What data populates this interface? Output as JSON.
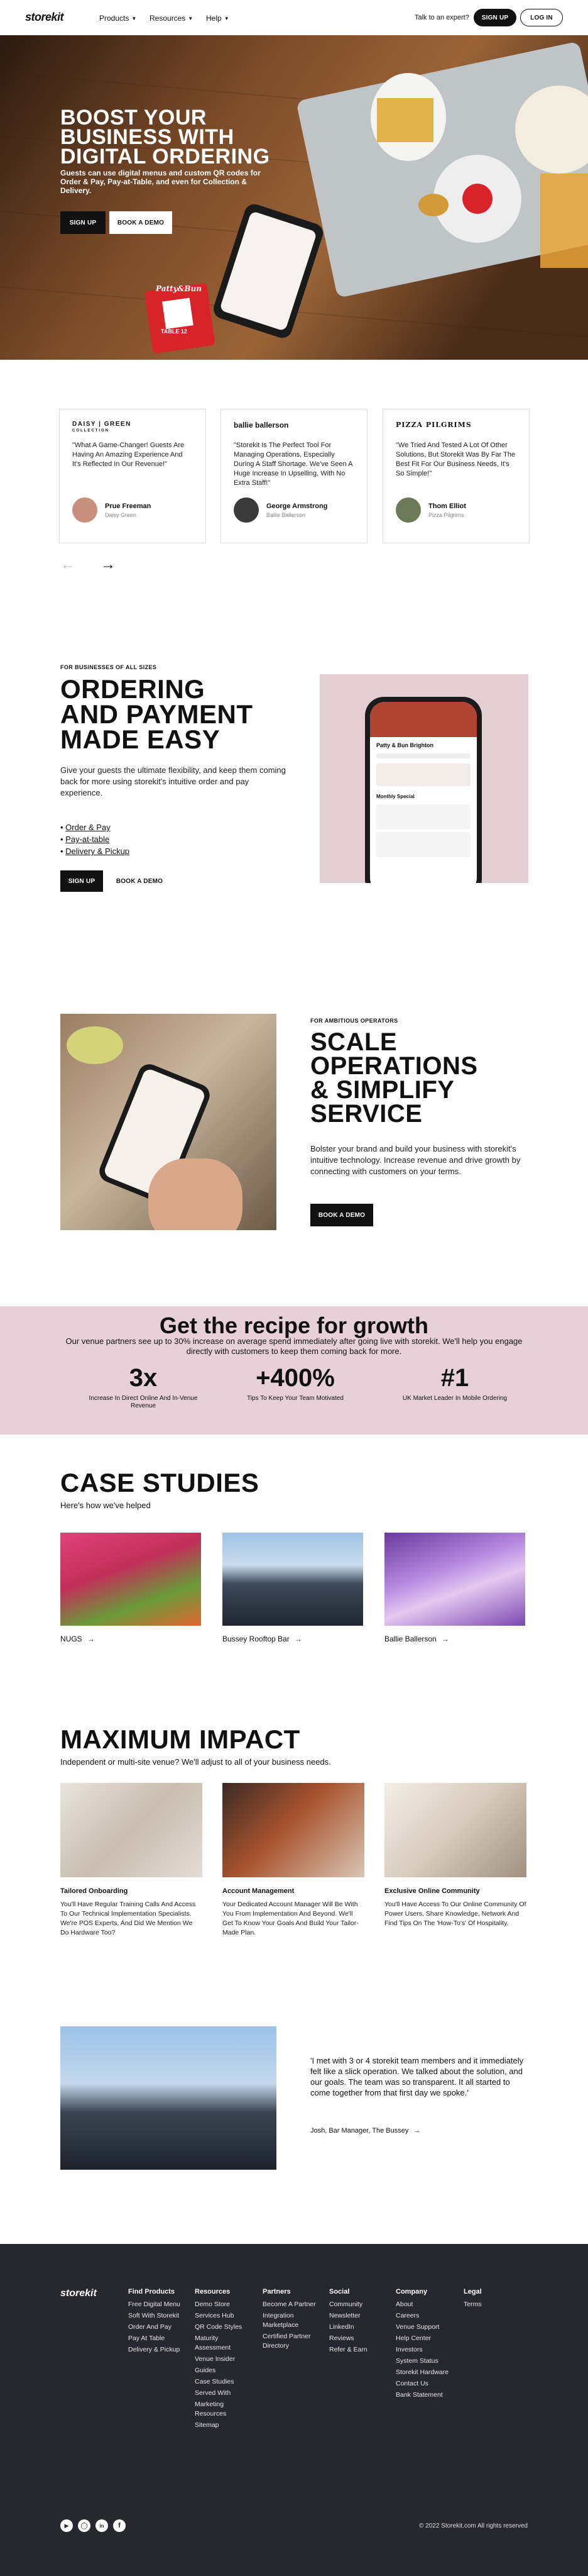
{
  "header": {
    "logo": "storekit",
    "nav": [
      {
        "label": "Products"
      },
      {
        "label": "Resources"
      },
      {
        "label": "Help"
      }
    ],
    "talk_link": "Talk to an expert?",
    "signup_label": "SIGN UP",
    "login_label": "LOG IN"
  },
  "hero": {
    "title_lines": [
      "BOOST YOUR",
      "BUSINESS WITH",
      "DIGITAL ORDERING"
    ],
    "subtitle": "Guests can use digital menus and custom QR codes for Order & Pay, Pay-at-Table, and even for Collection & Delivery.",
    "signup_label": "SIGN UP",
    "demo_label": "BOOK A DEMO",
    "table_card_label": "TABLE 12",
    "table_card_brand": "Patty&Bun"
  },
  "testimonials": [
    {
      "brand": "DAISY | GREEN",
      "brand_sub": "COLLECTION",
      "quote": "\"What A Game-Changer! Guests Are Having An Amazing Experience And It's Reflected In Our Revenue!\"",
      "name": "Prue Freeman",
      "role": "Daisy Green",
      "avatar_color": "#c98f7e"
    },
    {
      "brand": "ballie ballerson",
      "brand_sub": "",
      "quote": "\"Storekit Is The Perfect Tool For Managing Operations, Especially During A Staff Shortage. We've Seen A Huge Increase In Upselling, With No Extra Staff!\"",
      "name": "George Armstrong",
      "role": "Ballie Ballerson",
      "avatar_color": "#3a3a3a"
    },
    {
      "brand": "PIZZA PILGRIMS",
      "brand_sub": "",
      "quote": "\"We Tried And Tested A Lot Of Other Solutions, But Storekit Was By Far The Best Fit For Our Business Needs, It's So Simple!\"",
      "name": "Thom Elliot",
      "role": "Pizza Pilgrims",
      "avatar_color": "#6c7a5a"
    }
  ],
  "ordering": {
    "eyebrow": "FOR BUSINESSES OF ALL SIZES",
    "title_lines": [
      "ORDERING",
      "AND PAYMENT",
      "MADE EASY"
    ],
    "body": "Give your guests the ultimate flexibility, and keep them coming back for more using storekit's intuitive order and pay experience.",
    "bullets": [
      "Order & Pay",
      "Pay-at-table",
      "Delivery & Pickup"
    ],
    "signup_label": "SIGN UP",
    "demo_label": "BOOK A DEMO",
    "phone_brand": "Patty & Bun Brighton",
    "phone_section": "Monthly Special"
  },
  "scale": {
    "eyebrow": "FOR AMBITIOUS OPERATORS",
    "title_lines": [
      "SCALE",
      "OPERATIONS",
      "& SIMPLIFY",
      "SERVICE"
    ],
    "body": "Bolster your brand and build your business with storekit's intuitive technology. Increase revenue and drive growth by connecting with customers on your terms.",
    "demo_label": "BOOK A DEMO"
  },
  "growth": {
    "title": "Get the recipe for growth",
    "subtitle": "Our venue partners see up to 30% increase on average spend immediately after going live with storekit. We'll help you engage directly with customers to keep them coming back for more.",
    "stats": [
      {
        "value": "3x",
        "label": "Increase In Direct Online And In-Venue Revenue"
      },
      {
        "value": "+400%",
        "label": "Tips To Keep Your Team Motivated"
      },
      {
        "value": "#1",
        "label": "UK Market Leader In Mobile Ordering"
      }
    ]
  },
  "case_studies": {
    "title": "CASE STUDIES",
    "subtitle": "Here's how we've helped",
    "items": [
      {
        "label": "NUGS"
      },
      {
        "label": "Bussey Rooftop Bar"
      },
      {
        "label": "Ballie Ballerson"
      }
    ]
  },
  "impact": {
    "title": "MAXIMUM IMPACT",
    "subtitle": "Independent or multi-site venue? We'll adjust to all of your business needs.",
    "items": [
      {
        "title": "Tailored Onboarding",
        "desc": "You'll Have Regular Training Calls And Access To Our Technical Implementation Specialists. We're POS Experts, And Did We Mention We Do Hardware Too?"
      },
      {
        "title": "Account Management",
        "desc": "Your Dedicated Account Manager Will Be With You From Implementation And Beyond. We'll Get To Know Your Goals And Build Your Tailor-Made Plan."
      },
      {
        "title": "Exclusive Online Community",
        "desc": "You'll Have Access To Our Online Community Of Power Users, Share Knowledge, Network And Find Tips On The 'How-To's' Of Hospitality."
      }
    ]
  },
  "quote": {
    "text": "'I met with 3 or 4 storekit team members and it immediately felt like a slick operation. We talked about the solution, and our goals. The team was so transparent. It all started to come together from that first day we spoke.'",
    "attribution": "Josh, Bar Manager, The Bussey"
  },
  "footer": {
    "logo": "storekit",
    "columns": [
      {
        "heading": "Find Products",
        "items": [
          "Free Digital Menu",
          "Soft With Storekit",
          "Order And Pay",
          "Pay At Table",
          "Delivery & Pickup"
        ]
      },
      {
        "heading": "Resources",
        "items": [
          "Demo Store",
          "Services Hub",
          "QR Code Styles",
          "Maturity Assessment",
          "Venue Insider",
          "Guides",
          "Case Studies",
          "Served With",
          "Marketing Resources",
          "Sitemap"
        ]
      },
      {
        "heading": "Partners",
        "items": [
          "Become A Partner",
          "Integration Marketplace",
          "Certified Partner Directory"
        ]
      },
      {
        "heading": "Social",
        "items": [
          "Community",
          "Newsletter",
          "LinkedIn",
          "Reviews",
          "Refer & Earn"
        ]
      },
      {
        "heading": "Company",
        "items": [
          "About",
          "Careers",
          "Venue Support",
          "Help Center",
          "Investors",
          "System Status",
          "Storekit Hardware",
          "Contact Us",
          "Bank Statement"
        ]
      },
      {
        "heading": "Legal",
        "items": [
          "Terms"
        ]
      }
    ],
    "copyright": "© 2022 Storekit.com All rights reserved",
    "social_icons": [
      "youtube-icon",
      "instagram-icon",
      "linkedin-icon",
      "facebook-icon"
    ]
  },
  "colors": {
    "accent_pink": "#e7d0d7",
    "phone_bg_pink": "#e5cdd4",
    "footer_bg": "#27272f",
    "brand_red": "#d8232a"
  }
}
